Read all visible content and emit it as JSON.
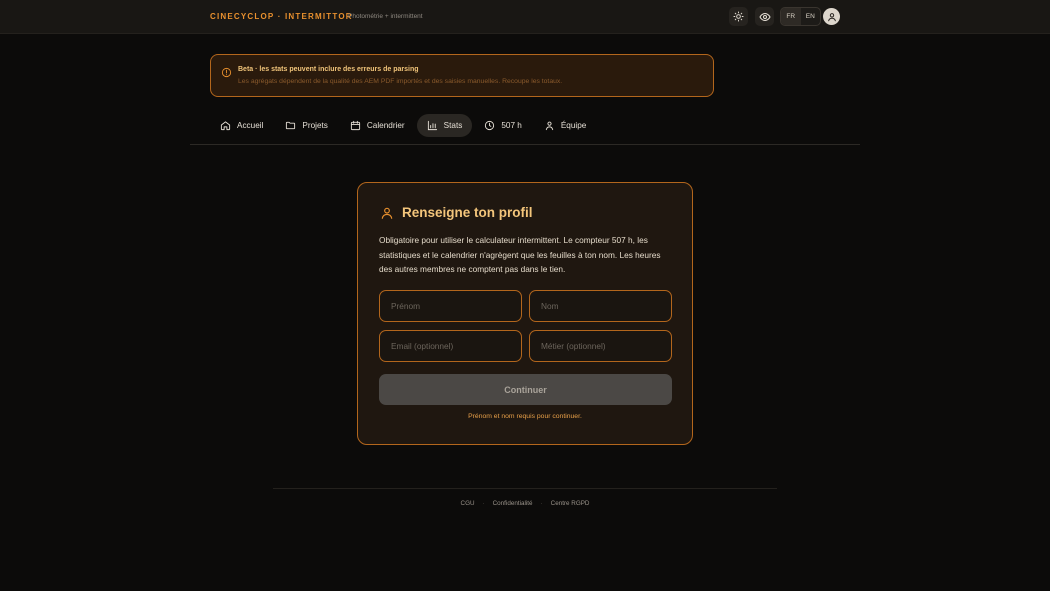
{
  "header": {
    "brand": "CINECYCLOP · INTERMITTOR",
    "tagline": "Photométrie + intermittent",
    "theme_icon": "sun-icon",
    "view_icon": "eye-icon",
    "lang_options": [
      "FR",
      "EN"
    ],
    "lang_selected": "FR",
    "account_icon": "user-icon"
  },
  "banner": {
    "title": "Beta · les stats peuvent inclure des erreurs de parsing",
    "text": "Les agrégats dépendent de la qualité des AEM PDF importés et des saisies manuelles. Recoupe les totaux.",
    "icon": "alert-circle-icon"
  },
  "nav": {
    "items": [
      {
        "label": "Accueil",
        "icon": "home-icon",
        "active": false
      },
      {
        "label": "Projets",
        "icon": "folder-icon",
        "active": false
      },
      {
        "label": "Calendrier",
        "icon": "calendar-icon",
        "active": false
      },
      {
        "label": "Stats",
        "icon": "bar-chart-icon",
        "active": true
      },
      {
        "label": "507 h",
        "icon": "clock-icon",
        "active": false
      },
      {
        "label": "Équipe",
        "icon": "person-icon",
        "active": false
      }
    ]
  },
  "profile": {
    "title": "Renseigne ton profil",
    "description": "Obligatoire pour utiliser le calculateur intermittent. Le compteur 507 h, les statistiques et le calendrier n'agrègent que les feuilles à ton nom. Les heures des autres membres ne comptent pas dans le tien.",
    "fields": {
      "first_name_placeholder": "Prénom",
      "last_name_placeholder": "Nom",
      "email_placeholder": "Email (optionnel)",
      "job_placeholder": "Métier (optionnel)"
    },
    "submit_label": "Continuer",
    "hint": "Prénom et nom requis pour continuer."
  },
  "footer": {
    "links": [
      "CGU",
      "Confidentialité",
      "Centre RGPD"
    ],
    "separator": "·"
  },
  "colors": {
    "accent": "#e8902e",
    "background": "#0c0b0a",
    "card_border": "#b3661c",
    "title": "#f3c57b"
  }
}
